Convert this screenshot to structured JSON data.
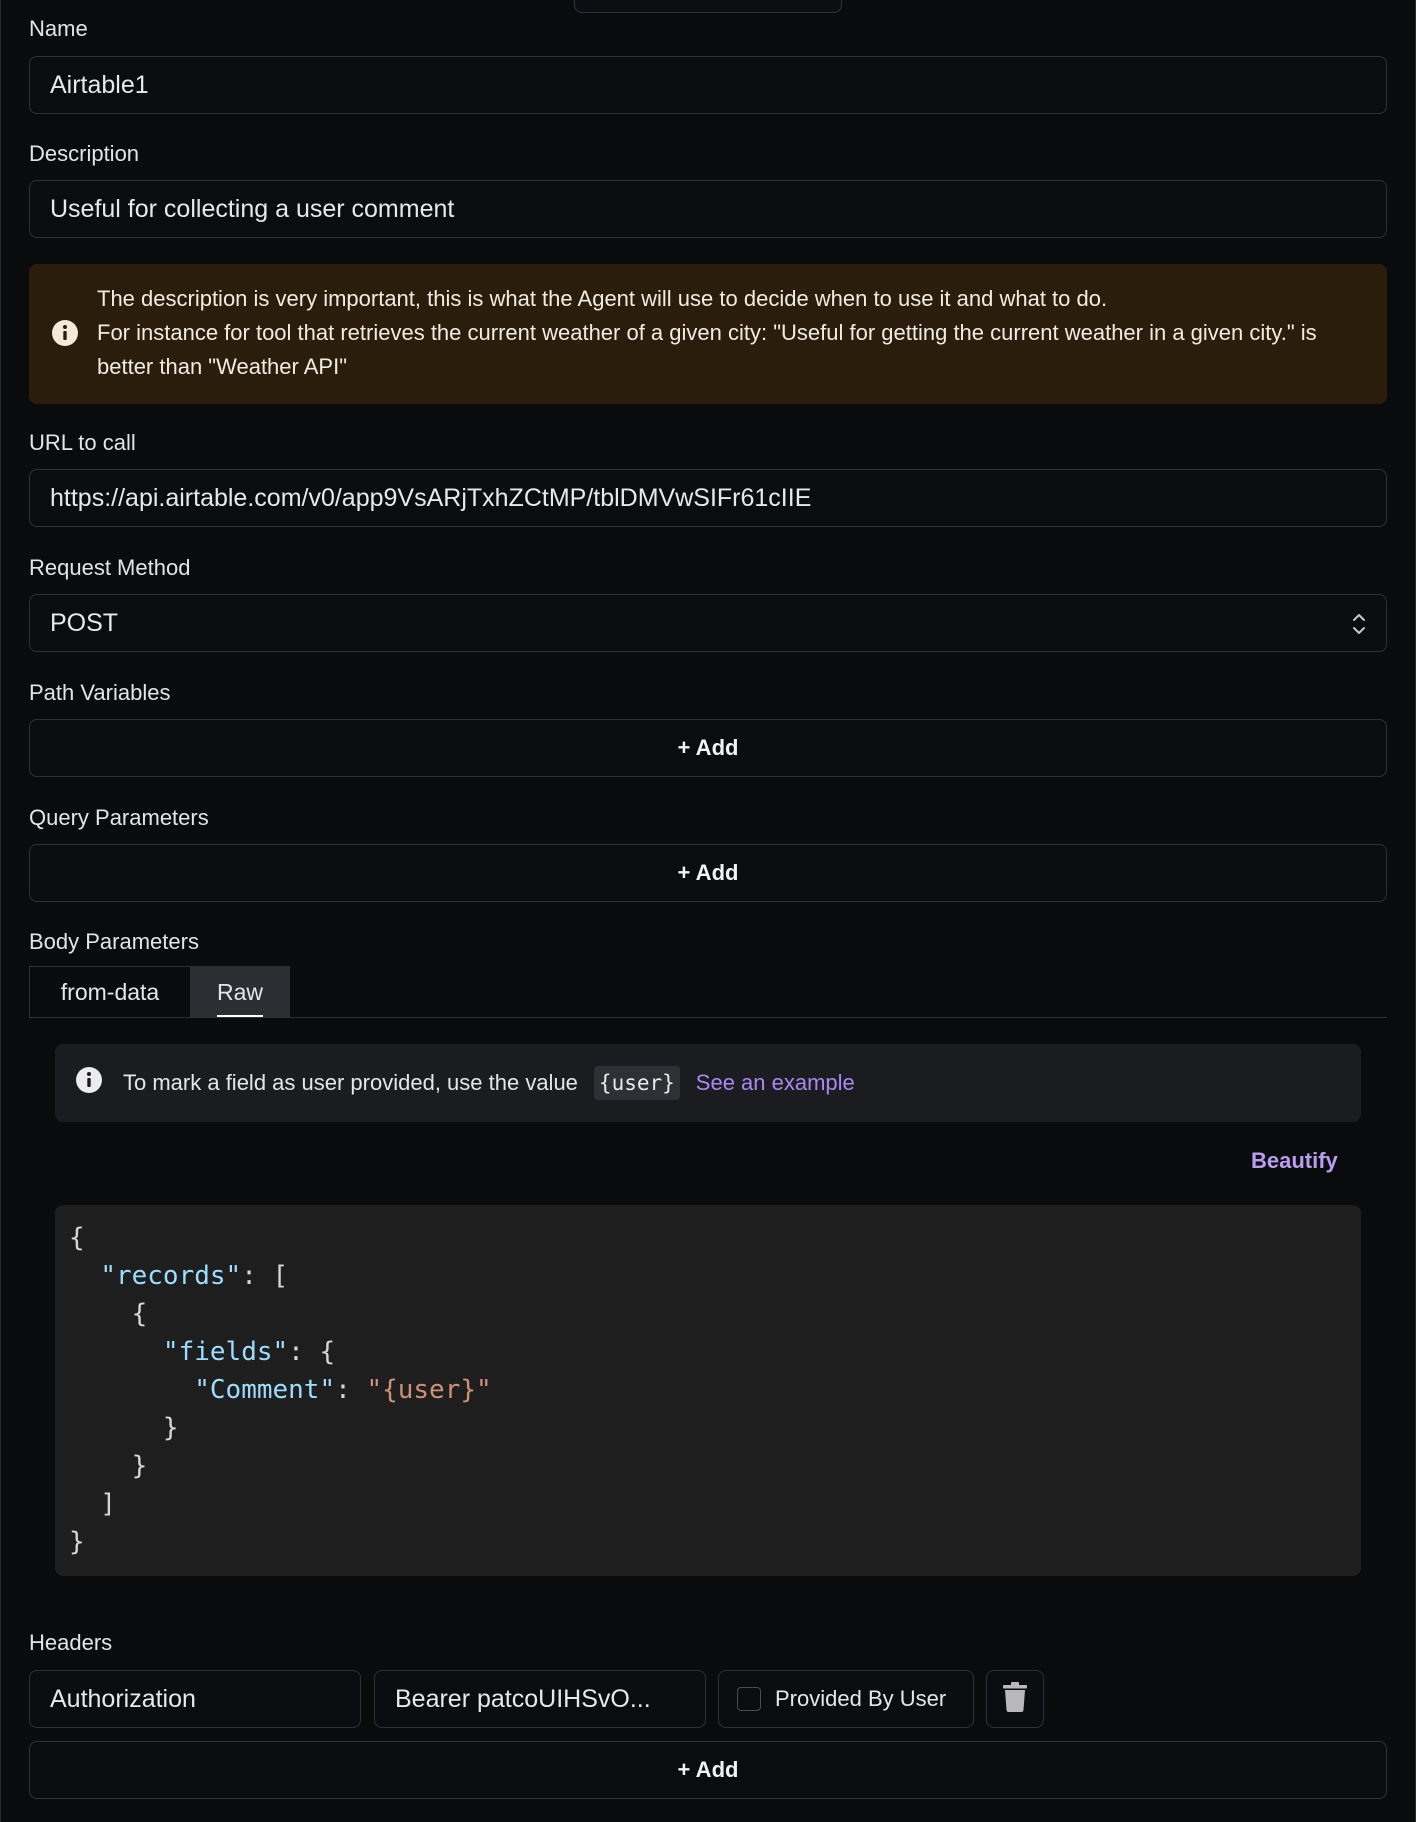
{
  "form": {
    "name": {
      "label": "Name",
      "value": "Airtable1"
    },
    "description": {
      "label": "Description",
      "value": "Useful for collecting a user comment"
    },
    "description_warning": {
      "icon": "info-icon",
      "line1": "The description is very important, this is what the Agent will use to decide when to use it and what to do.",
      "line2": "For instance for tool that retrieves the current weather of a given city: \"Useful for getting the current weather in a given city.\" is better than \"Weather API\""
    },
    "url": {
      "label": "URL to call",
      "value": "https://api.airtable.com/v0/app9VsARjTxhZCtMP/tblDMVwSIFr61cIIE"
    },
    "request_method": {
      "label": "Request Method",
      "value": "POST"
    },
    "path_variables": {
      "label": "Path Variables",
      "add_label": "+ Add"
    },
    "query_parameters": {
      "label": "Query Parameters",
      "add_label": "+ Add"
    },
    "body_parameters": {
      "label": "Body Parameters",
      "tabs": [
        {
          "label": "from-data",
          "active": false
        },
        {
          "label": "Raw",
          "active": true
        }
      ],
      "hint": {
        "text": "To mark a field as user provided, use the value",
        "code": "{user}",
        "link": "See an example"
      },
      "beautify_label": "Beautify",
      "code_lines": [
        [
          {
            "t": "p",
            "v": "{"
          }
        ],
        [
          {
            "t": "p",
            "v": "  "
          },
          {
            "t": "k",
            "v": "\"records\""
          },
          {
            "t": "p",
            "v": ": ["
          }
        ],
        [
          {
            "t": "p",
            "v": "    {"
          }
        ],
        [
          {
            "t": "p",
            "v": "      "
          },
          {
            "t": "k",
            "v": "\"fields\""
          },
          {
            "t": "p",
            "v": ": {"
          }
        ],
        [
          {
            "t": "p",
            "v": "        "
          },
          {
            "t": "k",
            "v": "\"Comment\""
          },
          {
            "t": "p",
            "v": ": "
          },
          {
            "t": "s",
            "v": "\"{user}\""
          }
        ],
        [
          {
            "t": "p",
            "v": "      }"
          }
        ],
        [
          {
            "t": "p",
            "v": "    }"
          }
        ],
        [
          {
            "t": "p",
            "v": "  ]"
          }
        ],
        [
          {
            "t": "p",
            "v": "}"
          }
        ]
      ]
    },
    "headers": {
      "label": "Headers",
      "rows": [
        {
          "key": "Authorization",
          "value": "Bearer patcoUIHSvO...",
          "provided_by_user_label": "Provided By User",
          "provided_by_user": false
        }
      ],
      "add_label": "+ Add"
    }
  },
  "colors": {
    "background": "#0a0b0d",
    "warning_bg": "#2a1d0c",
    "link": "#a987f2",
    "json_key": "#9cdcfe",
    "json_string": "#ce9178"
  }
}
